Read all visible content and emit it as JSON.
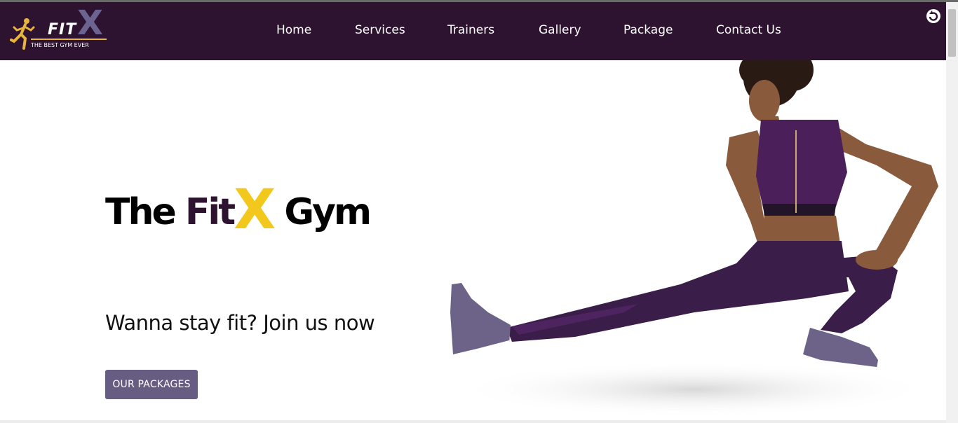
{
  "logo": {
    "brand_fit": "FIT",
    "brand_x": "X",
    "tagline": "THE BEST GYM EVER"
  },
  "nav": {
    "items": [
      {
        "label": "Home"
      },
      {
        "label": "Services"
      },
      {
        "label": "Trainers"
      },
      {
        "label": "Gallery"
      },
      {
        "label": "Package"
      },
      {
        "label": "Contact Us"
      }
    ]
  },
  "hero": {
    "title_the": "The ",
    "title_fit": "Fit",
    "title_x": "X",
    "title_gym": " Gym",
    "subtitle": "Wanna stay fit? Join us now",
    "cta_label": "OUR PACKAGES"
  },
  "icons": {
    "logo": "runner-icon",
    "extension": "refresh-icon"
  },
  "colors": {
    "navbar_bg": "#2e1330",
    "accent_yellow": "#f2c81d",
    "logo_x": "#6b6390",
    "button_bg": "#675c82"
  }
}
